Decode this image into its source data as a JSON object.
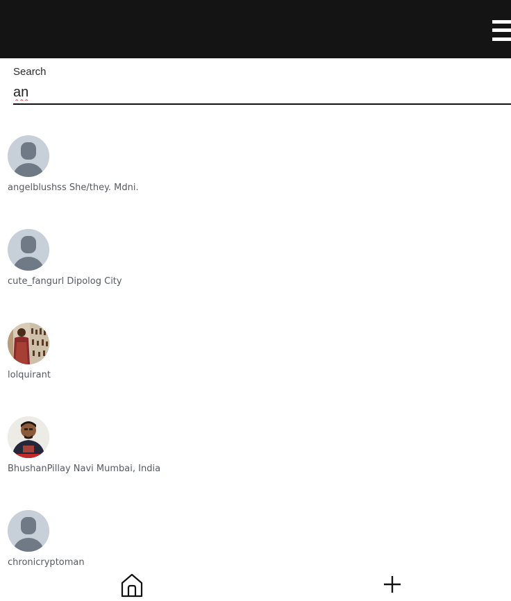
{
  "header": {
    "menu_icon": "hamburger-menu-icon",
    "background": "#141414"
  },
  "search": {
    "label": "Search",
    "value": "an"
  },
  "results": [
    {
      "text": "angelblushss She/they. Mdni.",
      "avatar": "default-avatar"
    },
    {
      "text": "cute_fangurl Dipolog City",
      "avatar": "default-avatar"
    },
    {
      "text": "lolquirant",
      "avatar": "photo-avatar"
    },
    {
      "text": "BhushanPillay Navi Mumbai, India",
      "avatar": "photo-avatar"
    },
    {
      "text": "chronicryptoman",
      "avatar": "default-avatar"
    }
  ],
  "bottom_nav": {
    "home_icon": "home-icon",
    "add_icon": "plus-icon"
  }
}
